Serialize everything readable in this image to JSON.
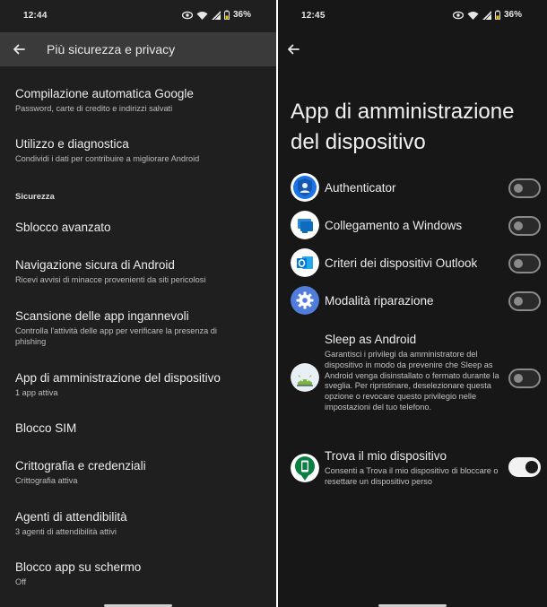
{
  "left": {
    "status": {
      "time": "12:44",
      "battery": "36%"
    },
    "header": {
      "title": "Più sicurezza e privacy"
    },
    "items": [
      {
        "title": "Compilazione automatica Google",
        "subtitle": "Password, carte di credito e indirizzi salvati"
      },
      {
        "title": "Utilizzo e diagnostica",
        "subtitle": "Condividi i dati per contribuire a migliorare Android"
      },
      {
        "title": "Sblocco avanzato",
        "subtitle": ""
      },
      {
        "title": "Navigazione sicura di Android",
        "subtitle": "Ricevi avvisi di minacce provenienti da siti pericolosi"
      },
      {
        "title": "Scansione delle app ingannevoli",
        "subtitle": "Controlla l'attività delle app per verificare la presenza di phishing"
      },
      {
        "title": "App di amministrazione del dispositivo",
        "subtitle": "1 app attiva"
      },
      {
        "title": "Blocco SIM",
        "subtitle": ""
      },
      {
        "title": "Crittografia e credenziali",
        "subtitle": "Crittografia attiva"
      },
      {
        "title": "Agenti di attendibilità",
        "subtitle": "3 agenti di attendibilità attivi"
      },
      {
        "title": "Blocco app su schermo",
        "subtitle": "Off"
      }
    ],
    "section_label": "Sicurezza"
  },
  "right": {
    "status": {
      "time": "12:45",
      "battery": "36%"
    },
    "title": "App di amministrazione del dispositivo",
    "apps": [
      {
        "name": "Authenticator",
        "description": "",
        "enabled": false,
        "icon": "authenticator-icon",
        "color": "#1a73e8"
      },
      {
        "name": "Collegamento a Windows",
        "description": "",
        "enabled": false,
        "icon": "windows-link-icon",
        "color": "#0f6cbd"
      },
      {
        "name": "Criteri dei dispositivi Outlook",
        "description": "",
        "enabled": false,
        "icon": "outlook-icon",
        "color": "#0078d4"
      },
      {
        "name": "Modalità riparazione",
        "description": "",
        "enabled": false,
        "icon": "gear-icon",
        "color": "#4f7dd9"
      },
      {
        "name": "Sleep as Android",
        "description": "Garantisci i privilegi da amministratore del dispositivo in modo da prevenire che Sleep as Android venga disinstallato o fermato durante la sveglia. Per ripristinare, deselezionare questa opzione o revocare questo privilegio nelle impostazioni del tuo telefono.",
        "enabled": false,
        "icon": "sleep-android-icon",
        "color": "#e8f0f6"
      },
      {
        "name": "Trova il mio dispositivo",
        "description": "Consenti a Trova il mio dispositivo di bloccare o resettare un dispositivo perso",
        "enabled": true,
        "icon": "find-device-icon",
        "color": "#0b8043"
      }
    ]
  }
}
